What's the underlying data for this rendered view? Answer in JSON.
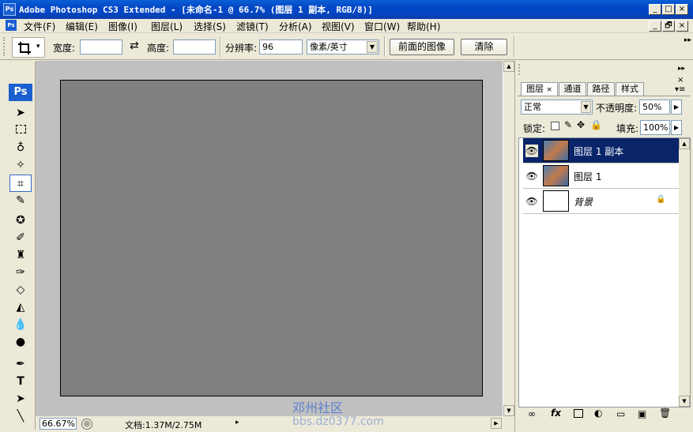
{
  "window": {
    "icon_text": "Ps",
    "title": "Adobe Photoshop CS3 Extended - [未命名-1 @ 66.7% (图层 1 副本, RGB/8)]",
    "buttons": [
      "_",
      "□",
      "×"
    ],
    "doc_buttons": [
      "_",
      "🗗",
      "×"
    ]
  },
  "menu": {
    "items": [
      "文件(F)",
      "编辑(E)",
      "图像(I)",
      "图层(L)",
      "选择(S)",
      "滤镜(T)",
      "分析(A)",
      "视图(V)",
      "窗口(W)",
      "帮助(H)"
    ]
  },
  "options": {
    "width_label": "宽度:",
    "width_value": "",
    "swap_icon": "⇄",
    "height_label": "高度:",
    "height_value": "",
    "resolution_label": "分辨率:",
    "resolution_value": "96",
    "unit_value": "像素/英寸",
    "front_image_button": "前面的图像",
    "clear_button": "清除"
  },
  "toolbox": {
    "logo": "Ps"
  },
  "status": {
    "zoom": "66.67%",
    "doc_info": "文档:1.37M/2.75M"
  },
  "watermark": {
    "line1": "邓州社区",
    "line2": "bbs.dz0377.com"
  },
  "layers_panel": {
    "tabs": [
      "图层",
      "通道",
      "路径",
      "样式"
    ],
    "blend_mode": "正常",
    "opacity_label": "不透明度:",
    "opacity_value": "50%",
    "lock_label": "锁定:",
    "fill_label": "填充:",
    "fill_value": "100%",
    "layers": [
      {
        "name": "图层 1 副本",
        "selected": true
      },
      {
        "name": "图层 1",
        "selected": false
      },
      {
        "name": "背景",
        "selected": false,
        "locked": true
      }
    ]
  },
  "colors": {
    "selection": "#0a246a",
    "titlebar": "#0346c4",
    "canvas": "#808080",
    "workspace": "#c0c0c0"
  }
}
